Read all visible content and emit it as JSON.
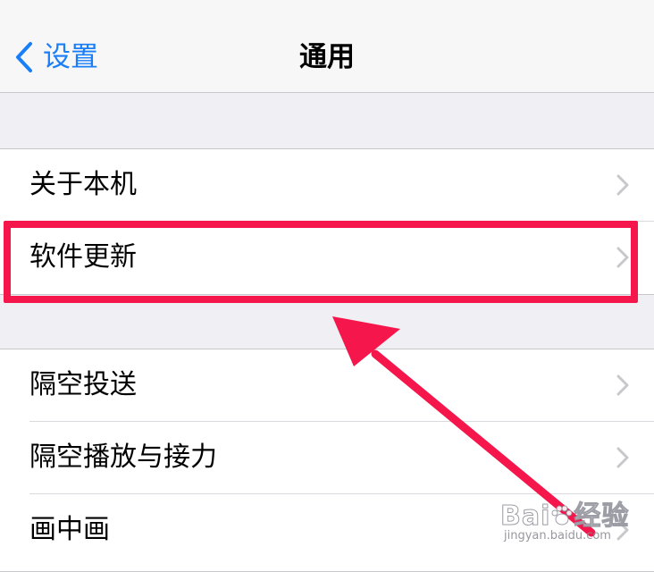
{
  "navbar": {
    "back_label": "设置",
    "title": "通用"
  },
  "groups": [
    {
      "items": [
        {
          "label": "关于本机"
        },
        {
          "label": "软件更新"
        }
      ]
    },
    {
      "items": [
        {
          "label": "隔空投送"
        },
        {
          "label": "隔空播放与接力"
        },
        {
          "label": "画中画"
        }
      ]
    }
  ],
  "annotation": {
    "highlight_color": "#f5164b",
    "highlighted_item": "软件更新"
  },
  "watermark": {
    "brand": "Bai",
    "brand_suffix": "经验",
    "url": "jingyan.baidu.com"
  },
  "colors": {
    "accent": "#1a7ff7",
    "background": "#efeff4"
  }
}
